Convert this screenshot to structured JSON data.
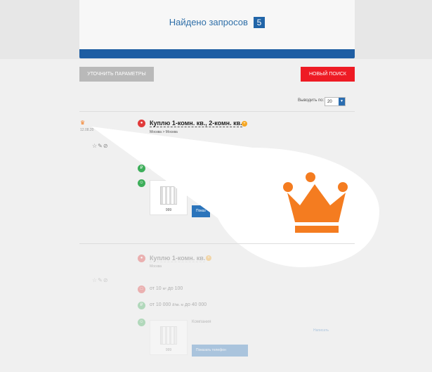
{
  "header": {
    "found_label": "Найдено запросов",
    "found_count": "5"
  },
  "toolbar": {
    "refine_label": "УТОЧНИТЬ ПАРАМЕТРЫ",
    "new_search_label": "НОВЫЙ ПОИСК"
  },
  "pagination": {
    "per_page_label": "Выводить по:",
    "per_page_value": "20"
  },
  "requests": [
    {
      "date": "12.08.20",
      "title": "Куплю 1-комн. кв., 2-комн. кв.",
      "location": "Москва > Москва",
      "price_prefix": "о",
      "photo_count": "999",
      "phone_label": "Показ"
    },
    {
      "title": "Куплю 1-комн. кв.",
      "location": "Москва",
      "area_from": "от 10",
      "area_to": "до 100",
      "area_unit": "м²",
      "price_from": "от 10 000",
      "price_to": "до 40 000",
      "price_unit": "₽/кв. м",
      "agent_type": "Компания",
      "photo_count": "999",
      "phone_label": "Показать телефон",
      "write_label": "Написать"
    }
  ],
  "colors": {
    "accent_blue": "#1f5ea3",
    "accent_red": "#ee1b24",
    "crown_orange": "#f47c20"
  }
}
